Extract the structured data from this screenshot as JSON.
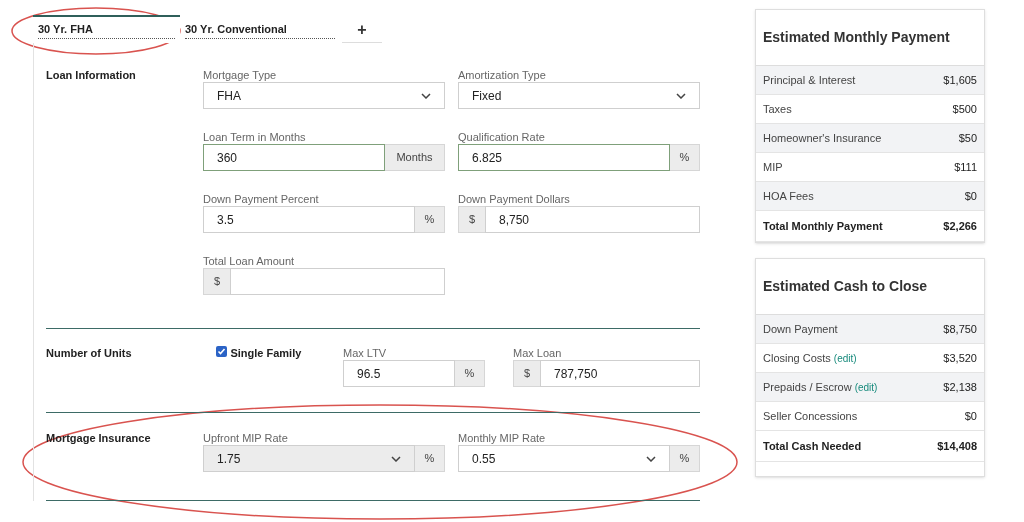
{
  "tabs": [
    {
      "kind": "scenario",
      "label": "30 Yr. FHA",
      "selected": true
    },
    {
      "kind": "scenario",
      "label": "30 Yr. Conventional",
      "selected": false
    },
    {
      "kind": "add",
      "label": "+",
      "selected": false
    }
  ],
  "loan_information": {
    "heading": "Loan Information",
    "fields": [
      {
        "kind": "select",
        "label": "Mortgage Type",
        "value": "FHA",
        "highlighted": false
      },
      {
        "kind": "select",
        "label": "Amortization Type",
        "value": "Fixed",
        "highlighted": false
      },
      {
        "kind": "suffix",
        "label": "Loan Term in Months",
        "value": "360",
        "addon": "Months",
        "highlighted": true
      },
      {
        "kind": "suffix",
        "label": "Qualification Rate",
        "value": "6.825",
        "addon": "%",
        "highlighted": true
      },
      {
        "kind": "suffix",
        "label": "Down Payment Percent",
        "value": "3.5",
        "addon": "%",
        "highlighted": false
      },
      {
        "kind": "prefix",
        "label": "Down Payment Dollars",
        "value": "8,750",
        "addon": "$",
        "highlighted": false
      },
      {
        "kind": "prefix",
        "label": "Total Loan Amount",
        "addon": "$",
        "highlighted": false
      }
    ]
  },
  "number_of_units": {
    "heading": "Number of Units",
    "checkbox": {
      "label": "Single Family",
      "checked": true
    },
    "fields": [
      {
        "kind": "suffix",
        "label": "Max LTV",
        "value": "96.5",
        "addon": "%",
        "highlighted": false
      },
      {
        "kind": "prefix",
        "label": "Max Loan",
        "value": "787,750",
        "addon": "$",
        "highlighted": false
      }
    ]
  },
  "mortgage_insurance": {
    "heading": "Mortgage Insurance",
    "fields": [
      {
        "kind": "select_suffix",
        "label": "Upfront MIP Rate",
        "value": "1.75",
        "addon": "%",
        "disabled": true
      },
      {
        "kind": "select_suffix",
        "label": "Monthly MIP Rate",
        "value": "0.55",
        "addon": "%",
        "disabled": false
      }
    ]
  },
  "summary_cards": [
    {
      "title": "Estimated Monthly Payment",
      "rows": [
        {
          "label": "Principal & Interest",
          "value": "$1,605",
          "total": false
        },
        {
          "label": "Taxes",
          "value": "$500",
          "total": false
        },
        {
          "label": "Homeowner's Insurance",
          "value": "$50",
          "total": false
        },
        {
          "label": "MIP",
          "value": "$111",
          "total": false
        },
        {
          "label": "HOA Fees",
          "value": "$0",
          "total": false
        },
        {
          "label": "Total Monthly Payment",
          "value": "$2,266",
          "total": true
        }
      ]
    },
    {
      "title": "Estimated Cash to Close",
      "rows": [
        {
          "label": "Down Payment",
          "value": "$8,750",
          "total": false
        },
        {
          "label": "Closing Costs",
          "link": "(edit)",
          "value": "$3,520",
          "total": false
        },
        {
          "label": "Prepaids / Escrow",
          "link": "(edit)",
          "value": "$2,138",
          "total": false
        },
        {
          "label": "Seller Concessions",
          "value": "$0",
          "total": false
        },
        {
          "label": "Total Cash Needed",
          "value": "$14,408",
          "total": true
        }
      ]
    }
  ]
}
